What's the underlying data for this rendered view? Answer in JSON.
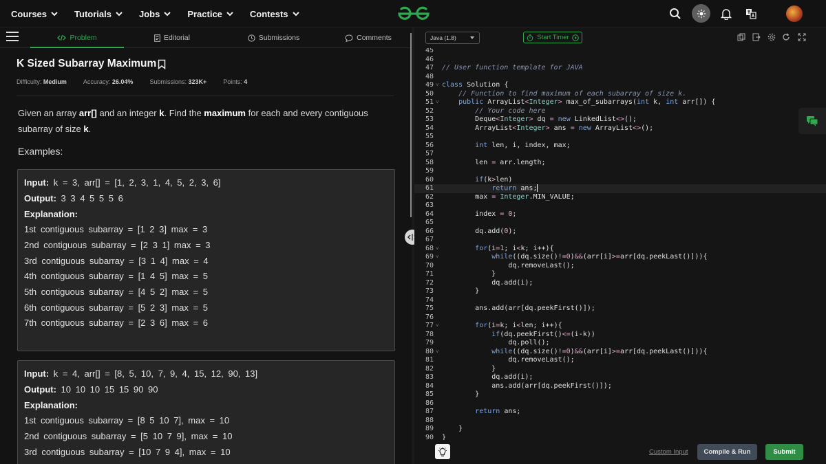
{
  "nav": {
    "items": [
      "Courses",
      "Tutorials",
      "Jobs",
      "Practice",
      "Contests"
    ],
    "logo_text": "GfG"
  },
  "tabs": {
    "problem": "Problem",
    "editorial": "Editorial",
    "submissions": "Submissions",
    "comments": "Comments"
  },
  "problem": {
    "title": "K Sized Subarray Maximum",
    "difficulty_label": "Difficulty:",
    "difficulty": "Medium",
    "accuracy_label": "Accuracy:",
    "accuracy": "26.04%",
    "submissions_label": "Submissions:",
    "submissions": "323K+",
    "points_label": "Points:",
    "points": "4",
    "desc_1": "Given an array ",
    "desc_arr": "arr[]",
    "desc_2": " and an integer ",
    "desc_k": "k",
    "desc_3": ". Find the ",
    "desc_max": "maximum",
    "desc_4": " for each and every contiguous subarray of size ",
    "desc_k2": "k",
    "desc_5": ".",
    "examples_heading": "Examples:"
  },
  "examples": [
    {
      "input_label": "Input:",
      "input": " k = 3, arr[] = [1, 2, 3, 1, 4, 5, 2, 3, 6]",
      "output_label": "Output:",
      "output": " 3 3 4 5 5 5 6",
      "explanation_label": "Explanation:",
      "lines": [
        "1st contiguous subarray = [1 2 3] max = 3",
        "2nd contiguous subarray = [2 3 1] max = 3",
        "3rd contiguous subarray = [3 1 4] max = 4",
        "4th contiguous subarray = [1 4 5] max = 5",
        "5th contiguous subarray = [4 5 2] max = 5",
        "6th contiguous subarray = [5 2 3] max = 5",
        "7th contiguous subarray = [2 3 6] max = 6"
      ]
    },
    {
      "input_label": "Input:",
      "input": " k = 4, arr[] = [8, 5, 10, 7, 9, 4, 15, 12, 90, 13]",
      "output_label": "Output:",
      "output": " 10 10 10 15 15 90 90",
      "explanation_label": "Explanation:",
      "lines": [
        "1st contiguous subarray = [8 5 10 7], max = 10",
        "2nd contiguous subarray = [5 10 7 9], max = 10",
        "3rd contiguous subarray = [10 7 9 4], max = 10"
      ]
    }
  ],
  "editor": {
    "language": "Java (1.8)",
    "timer_label": "Start Timer",
    "custom_input": "Custom Input",
    "compile_run": "Compile & Run",
    "submit": "Submit",
    "code": [
      {
        "n": "45",
        "t": ""
      },
      {
        "n": "46",
        "t": ""
      },
      {
        "n": "47",
        "t": "// User function template for JAVA"
      },
      {
        "n": "48",
        "t": ""
      },
      {
        "n": "49",
        "t": "class Solution {",
        "f": true
      },
      {
        "n": "50",
        "t": "    // Function to find maximum of each subarray of size k."
      },
      {
        "n": "51",
        "t": "    public ArrayList<Integer> max_of_subarrays(int k, int arr[]) {",
        "f": true
      },
      {
        "n": "52",
        "t": "        // Your code here"
      },
      {
        "n": "53",
        "t": "        Deque<Integer> dq = new LinkedList<>();"
      },
      {
        "n": "54",
        "t": "        ArrayList<Integer> ans = new ArrayList<>();"
      },
      {
        "n": "55",
        "t": ""
      },
      {
        "n": "56",
        "t": "        int len, i, index, max;"
      },
      {
        "n": "57",
        "t": ""
      },
      {
        "n": "58",
        "t": "        len = arr.length;"
      },
      {
        "n": "59",
        "t": ""
      },
      {
        "n": "60",
        "t": "        if(k>len)"
      },
      {
        "n": "61",
        "t": "            return ans;",
        "hl": true
      },
      {
        "n": "62",
        "t": "        max = Integer.MIN_VALUE;"
      },
      {
        "n": "63",
        "t": ""
      },
      {
        "n": "64",
        "t": "        index = 0;"
      },
      {
        "n": "65",
        "t": ""
      },
      {
        "n": "66",
        "t": "        dq.add(0);"
      },
      {
        "n": "67",
        "t": ""
      },
      {
        "n": "68",
        "t": "        for(i=1; i<k; i++){",
        "f": true
      },
      {
        "n": "69",
        "t": "            while((dq.size()!=0)&&(arr[i]>=arr[dq.peekLast()])){",
        "f": true
      },
      {
        "n": "70",
        "t": "                dq.removeLast();"
      },
      {
        "n": "71",
        "t": "            }"
      },
      {
        "n": "72",
        "t": "            dq.add(i);"
      },
      {
        "n": "73",
        "t": "        }"
      },
      {
        "n": "74",
        "t": ""
      },
      {
        "n": "75",
        "t": "        ans.add(arr[dq.peekFirst()]);"
      },
      {
        "n": "76",
        "t": ""
      },
      {
        "n": "77",
        "t": "        for(i=k; i<len; i++){",
        "f": true
      },
      {
        "n": "78",
        "t": "            if(dq.peekFirst()<=(i-k))"
      },
      {
        "n": "79",
        "t": "                dq.poll();"
      },
      {
        "n": "80",
        "t": "            while((dq.size()!=0)&&(arr[i]>=arr[dq.peekLast()])){",
        "f": true
      },
      {
        "n": "81",
        "t": "                dq.removeLast();"
      },
      {
        "n": "82",
        "t": "            }"
      },
      {
        "n": "83",
        "t": "            dq.add(i);"
      },
      {
        "n": "84",
        "t": "            ans.add(arr[dq.peekFirst()]);"
      },
      {
        "n": "85",
        "t": "        }"
      },
      {
        "n": "86",
        "t": ""
      },
      {
        "n": "87",
        "t": "        return ans;"
      },
      {
        "n": "88",
        "t": ""
      },
      {
        "n": "89",
        "t": "    }"
      },
      {
        "n": "90",
        "t": "}"
      }
    ]
  },
  "colors": {
    "accent_green": "#2fa84f",
    "submit_green": "#2f8d46",
    "keyword": "#7da8e8",
    "comment": "#8b95b0",
    "number": "#e8a8d0"
  },
  "icons": [
    "hamburger-icon",
    "code-icon",
    "editorial-icon",
    "clock-icon",
    "comment-icon",
    "bookmark-icon",
    "search-icon",
    "theme-toggle-icon",
    "bell-icon",
    "translate-icon",
    "copy-icon",
    "export-icon",
    "settings-icon",
    "refresh-icon",
    "fullscreen-icon",
    "play-icon",
    "chat-icon",
    "bulb-icon",
    "drag-handle-icon"
  ]
}
